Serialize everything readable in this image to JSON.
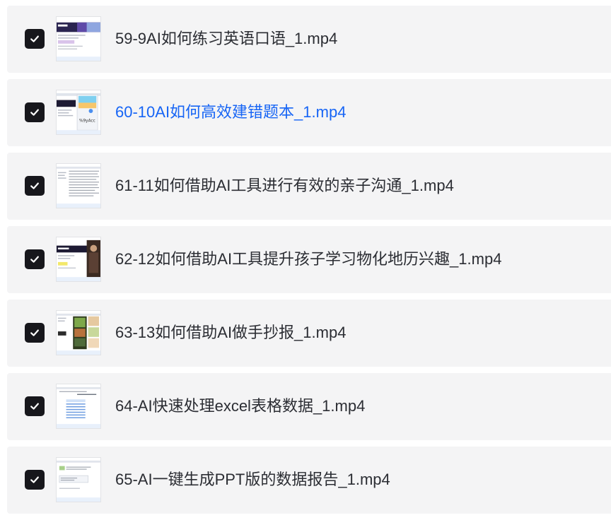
{
  "files": [
    {
      "name": "59-9AI如何练习英语口语_1.mp4",
      "checked": true,
      "highlighted": false,
      "thumbnail": "webpage-dark-banner"
    },
    {
      "name": "60-10AI如何高效建错题本_1.mp4",
      "checked": true,
      "highlighted": true,
      "thumbnail": "app-with-phone-panel"
    },
    {
      "name": "61-11如何借助AI工具进行有效的亲子沟通_1.mp4",
      "checked": true,
      "highlighted": false,
      "thumbnail": "text-document"
    },
    {
      "name": "62-12如何借助AI工具提升孩子学习物化地历兴趣_1.mp4",
      "checked": true,
      "highlighted": false,
      "thumbnail": "webpage-with-portrait"
    },
    {
      "name": "63-13如何借助AI做手抄报_1.mp4",
      "checked": true,
      "highlighted": false,
      "thumbnail": "image-gallery"
    },
    {
      "name": "64-AI快速处理excel表格数据_1.mp4",
      "checked": true,
      "highlighted": false,
      "thumbnail": "spreadsheet"
    },
    {
      "name": "65-AI一键生成PPT版的数据报告_1.mp4",
      "checked": true,
      "highlighted": false,
      "thumbnail": "chat-document"
    }
  ],
  "colors": {
    "row_background": "#f4f4f5",
    "checkbox": "#17171c",
    "text": "#2b2d33",
    "highlight_text": "#1765f5"
  },
  "icons": {
    "checkbox": "check-icon"
  }
}
